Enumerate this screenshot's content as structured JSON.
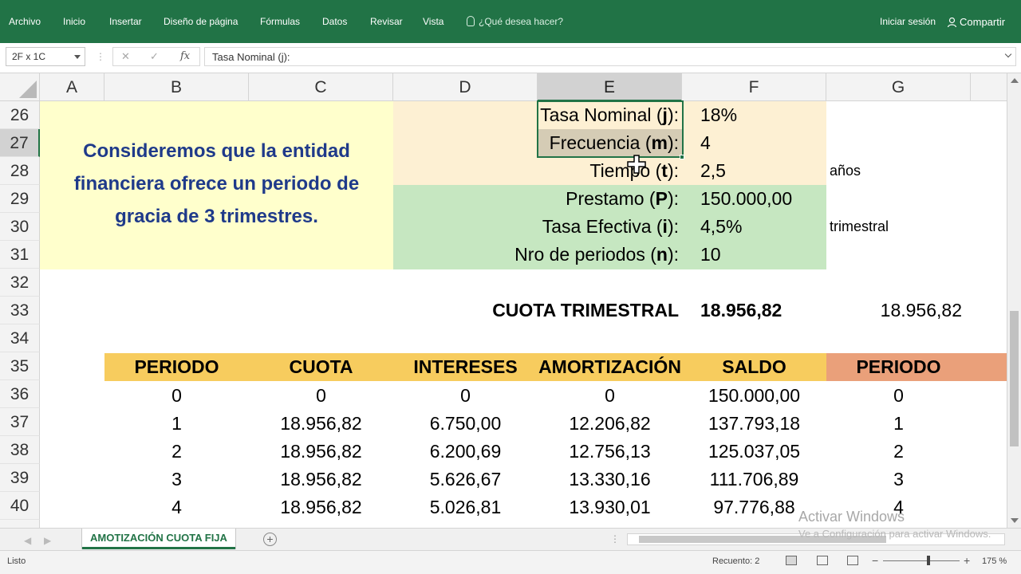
{
  "ribbon": {
    "tabs": [
      "Archivo",
      "Inicio",
      "Insertar",
      "Diseño de página",
      "Fórmulas",
      "Datos",
      "Revisar",
      "Vista"
    ],
    "tell_me": "¿Qué desea hacer?",
    "sign_in": "Iniciar sesión",
    "share": "Compartir"
  },
  "formula_bar": {
    "name_box": "2F x 1C",
    "cancel": "✕",
    "enter": "✓",
    "fx": "fx",
    "content": "Tasa Nominal (j):"
  },
  "columns": [
    "A",
    "B",
    "C",
    "D",
    "E",
    "F",
    "G"
  ],
  "rows": [
    "26",
    "27",
    "28",
    "29",
    "30",
    "31",
    "32",
    "33",
    "34",
    "35",
    "36",
    "37",
    "38",
    "39",
    "40"
  ],
  "note": {
    "line1": "Consideremos que la entidad",
    "line2": "financiera ofrece un periodo de",
    "line3": "gracia de 3 trimestres."
  },
  "params": [
    {
      "pre": "Tasa Nominal (",
      "key": "j",
      "post": "):",
      "value": "18%",
      "extra": ""
    },
    {
      "pre": "Frecuencia (",
      "key": "m",
      "post": "):",
      "value": "4",
      "extra": ""
    },
    {
      "pre": "Tiempo (",
      "key": "t",
      "post": "):",
      "value": "2,5",
      "extra": "años"
    },
    {
      "pre": "Prestamo (",
      "key": "P",
      "post": "):",
      "value": "150.000,00",
      "extra": ""
    },
    {
      "pre": "Tasa Efectiva (",
      "key": "i",
      "post": "):",
      "value": "4,5%",
      "extra": "trimestral"
    },
    {
      "pre": "Nro de periodos (",
      "key": "n",
      "post": "):",
      "value": "10",
      "extra": ""
    }
  ],
  "cuota": {
    "label": "CUOTA TRIMESTRAL",
    "value": "18.956,82",
    "value_plain": "18.956,82"
  },
  "table": {
    "headers": [
      "PERIODO",
      "CUOTA",
      "INTERESES",
      "AMORTIZACIÓN",
      "SALDO",
      "PERIODO"
    ],
    "rows": [
      {
        "periodo": "0",
        "cuota": "0",
        "intereses": "0",
        "amortizacion": "0",
        "saldo": "150.000,00",
        "periodo2": "0"
      },
      {
        "periodo": "1",
        "cuota": "18.956,82",
        "intereses": "6.750,00",
        "amortizacion": "12.206,82",
        "saldo": "137.793,18",
        "periodo2": "1"
      },
      {
        "periodo": "2",
        "cuota": "18.956,82",
        "intereses": "6.200,69",
        "amortizacion": "12.756,13",
        "saldo": "125.037,05",
        "periodo2": "2"
      },
      {
        "periodo": "3",
        "cuota": "18.956,82",
        "intereses": "5.626,67",
        "amortizacion": "13.330,16",
        "saldo": "111.706,89",
        "periodo2": "3"
      },
      {
        "periodo": "4",
        "cuota": "18.956,82",
        "intereses": "5.026,81",
        "amortizacion": "13.930,01",
        "saldo": "97.776,88",
        "periodo2": "4"
      }
    ]
  },
  "sheet_tab": "AMOTIZACIÓN CUOTA FIJA",
  "status": {
    "ready": "Listo",
    "count": "Recuento: 2",
    "zoom": "175 %",
    "zoom_minus": "−",
    "zoom_plus": "+"
  },
  "watermark": {
    "line1": "Activar Windows",
    "line2": "Ve a Configuración para activar Windows."
  },
  "colors": {
    "ribbon": "#217346",
    "note_fill": "#ffffcc",
    "params_orange": "#fdf0d3",
    "params_green": "#c6e7c1",
    "header_gold": "#f7cc5e",
    "header_salmon": "#eaa07a",
    "note_text": "#1f3a8a"
  }
}
